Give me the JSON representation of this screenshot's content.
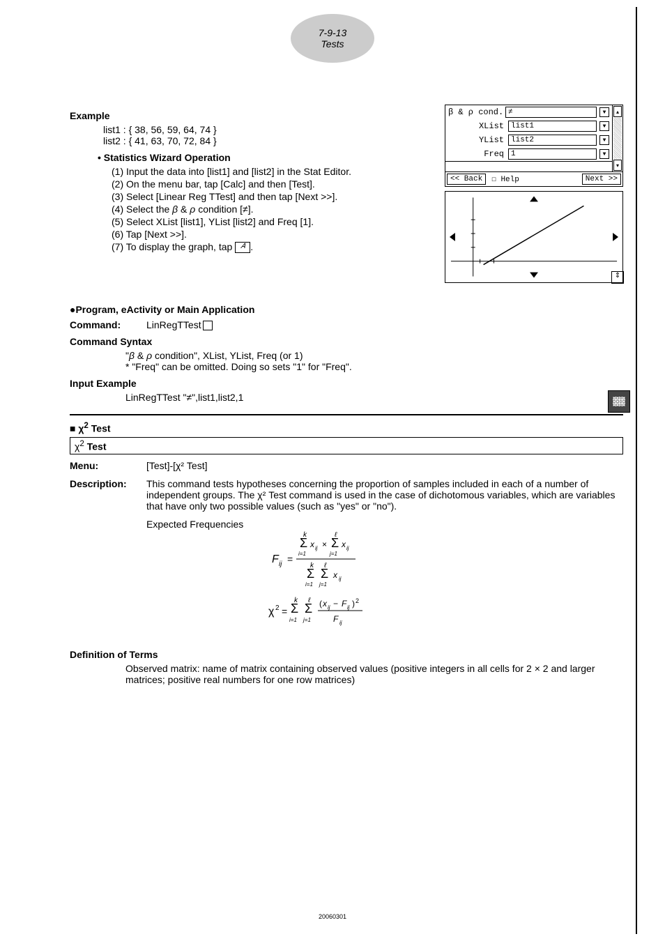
{
  "header": {
    "line1": "7-9-13",
    "line2": "Tests"
  },
  "example": {
    "title": "Example",
    "list1": "list1 : { 38, 56, 59, 64, 74 }",
    "list2": "list2 : { 41, 63, 70, 72, 84 }",
    "wizard_title": "• Statistics Wizard Operation",
    "steps": {
      "s1": "(1) Input the data into [list1] and [list2] in the Stat Editor.",
      "s2": "(2) On the menu bar, tap [Calc] and then [Test].",
      "s3": "(3) Select [Linear Reg TTest] and then tap [Next >>].",
      "s4a": "(4) Select the ",
      "s4b": " condition [≠].",
      "s5": "(5) Select XList [list1], YList [list2] and Freq [1].",
      "s6": "(6) Tap [Next >>].",
      "s7a": "(7) To display the graph, tap ",
      "s7b": "."
    }
  },
  "calc": {
    "cond_label": "β & ρ cond.",
    "cond_val": "≠",
    "xlist_label": "XList",
    "xlist_val": "list1",
    "ylist_label": "YList",
    "ylist_val": "list2",
    "freq_label": "Freq",
    "freq_val": "1",
    "back": "<< Back",
    "help": "Help",
    "next": "Next >>"
  },
  "program": {
    "title": "●Program, eActivity or Main Application",
    "command_label": "Command:",
    "command_val": "LinRegTTest",
    "syntax_title": "Command Syntax",
    "syntax_line1a": "\"",
    "syntax_line1b": " condition\", XList, YList, Freq (or 1)",
    "syntax_line2": "* \"Freq\" can be omitted. Doing so sets \"1\" for \"Freq\".",
    "input_title": "Input Example",
    "input_val": "LinRegTTest  \"≠\",list1,list2,1"
  },
  "chi": {
    "heading": "Test",
    "box": "Test",
    "menu_label": "Menu:",
    "menu_val": "[Test]-[χ² Test]",
    "desc_label": "Description:",
    "desc_text1": "This command tests hypotheses concerning the proportion of samples included in each of a number of independent groups. The χ² Test command is used in the case of dichotomous variables, which are variables that have only two possible values (such as \"yes\" or \"no\").",
    "expected": "Expected Frequencies",
    "def_title": "Definition of Terms",
    "def_text": "Observed matrix: name of matrix containing observed values (positive integers in all cells for 2 × 2 and larger matrices; positive real numbers for one row matrices)"
  },
  "footer": "20060301"
}
